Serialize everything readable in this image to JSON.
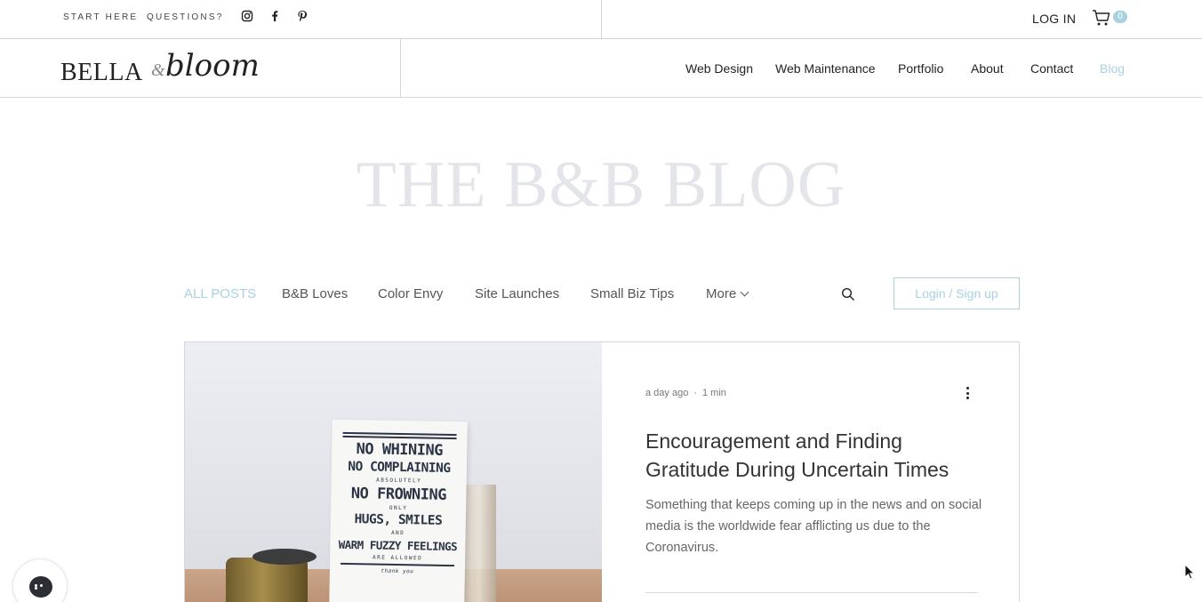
{
  "topbar": {
    "links": [
      "START HERE",
      "QUESTIONS?"
    ],
    "social_icons": [
      "instagram-icon",
      "facebook-icon",
      "pinterest-icon"
    ],
    "login_label": "LOG IN",
    "cart_count": "0"
  },
  "brand": {
    "logo_part1": "BELLA",
    "logo_amp": "&",
    "logo_part2": "bloom"
  },
  "nav": {
    "items": [
      "Web Design",
      "Web Maintenance",
      "Portfolio",
      "About",
      "Contact",
      "Blog"
    ],
    "active": "Blog",
    "active_color": "#a9d1e0"
  },
  "hero": {
    "title": "THE B&B BLOG"
  },
  "blog_menu": {
    "categories": [
      "ALL POSTS",
      "B&B Loves",
      "Color Envy",
      "Site Launches",
      "Small Biz Tips"
    ],
    "more_label": "More",
    "login_button": "Login / Sign up"
  },
  "post": {
    "time_ago": "a day ago",
    "separator": "·",
    "read_time": "1 min",
    "title": "Encouragement and Finding Gratitude During Uncertain Times",
    "excerpt": "Something that keeps coming up in the news and on social media is the worldwide fear afflicting us due to the Coronavirus.",
    "image_sign": {
      "line1": "NO WHINING",
      "line2": "NO COMPLAINING",
      "line3": "ABSOLUTELY",
      "line4": "NO FROWNING",
      "line5": "ONLY",
      "line6": "HUGS, SMILES",
      "line7": "AND",
      "line8": "WARM FUZZY FEELINGS",
      "line9": "ARE ALLOWED",
      "line10": "thank you"
    }
  },
  "chat": {
    "icon": "chat-bubble-icon"
  }
}
